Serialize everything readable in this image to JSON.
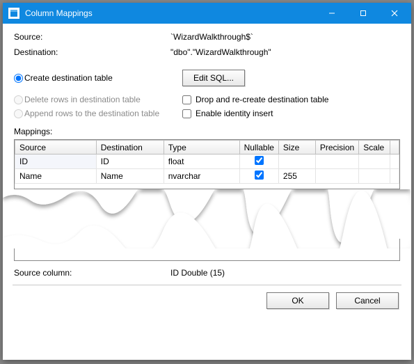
{
  "window": {
    "title": "Column Mappings"
  },
  "fields": {
    "source_label": "Source:",
    "source_value": "`WizardWalkthrough$`",
    "destination_label": "Destination:",
    "destination_value": "\"dbo\".\"WizardWalkthrough\""
  },
  "options": {
    "create_table": "Create destination table",
    "edit_sql": "Edit SQL...",
    "delete_rows": "Delete rows in destination table",
    "drop_recreate": "Drop and re-create destination table",
    "append_rows": "Append rows to the destination table",
    "enable_identity": "Enable identity insert"
  },
  "mappings": {
    "label": "Mappings:",
    "headers": {
      "source": "Source",
      "destination": "Destination",
      "type": "Type",
      "nullable": "Nullable",
      "size": "Size",
      "precision": "Precision",
      "scale": "Scale"
    },
    "rows": [
      {
        "source": "ID",
        "destination": "ID",
        "type": "float",
        "nullable": true,
        "size": "",
        "precision": "",
        "scale": ""
      },
      {
        "source": "Name",
        "destination": "Name",
        "type": "nvarchar",
        "nullable": true,
        "size": "255",
        "precision": "",
        "scale": ""
      }
    ]
  },
  "footer": {
    "source_column_label": "Source column:",
    "source_column_value": "ID Double (15)"
  },
  "buttons": {
    "ok": "OK",
    "cancel": "Cancel"
  }
}
